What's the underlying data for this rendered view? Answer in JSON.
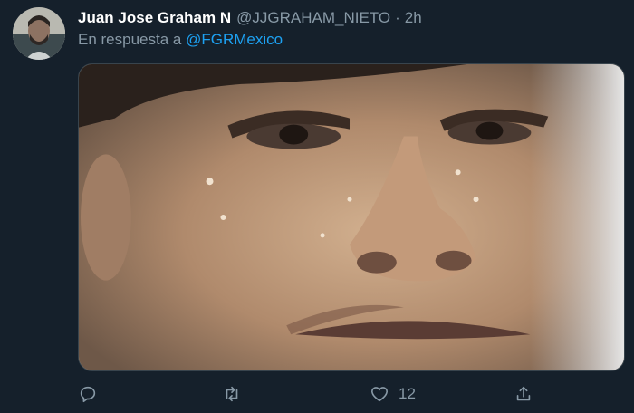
{
  "tweet": {
    "author": {
      "display_name": "Juan Jose Graham N",
      "handle": "@JJGRAHAM_NIETO"
    },
    "separator": "·",
    "time": "2h",
    "reply_prefix": "En respuesta a",
    "reply_to": "@FGRMexico",
    "actions": {
      "reply": {
        "icon": "reply-icon",
        "count": ""
      },
      "retweet": {
        "icon": "retweet-icon",
        "count": ""
      },
      "like": {
        "icon": "heart-icon",
        "count": "12"
      },
      "share": {
        "icon": "share-icon",
        "count": ""
      }
    }
  },
  "colors": {
    "background": "#15202b",
    "secondary_text": "#8899a6",
    "link": "#1da1f2",
    "border": "#38444d"
  }
}
